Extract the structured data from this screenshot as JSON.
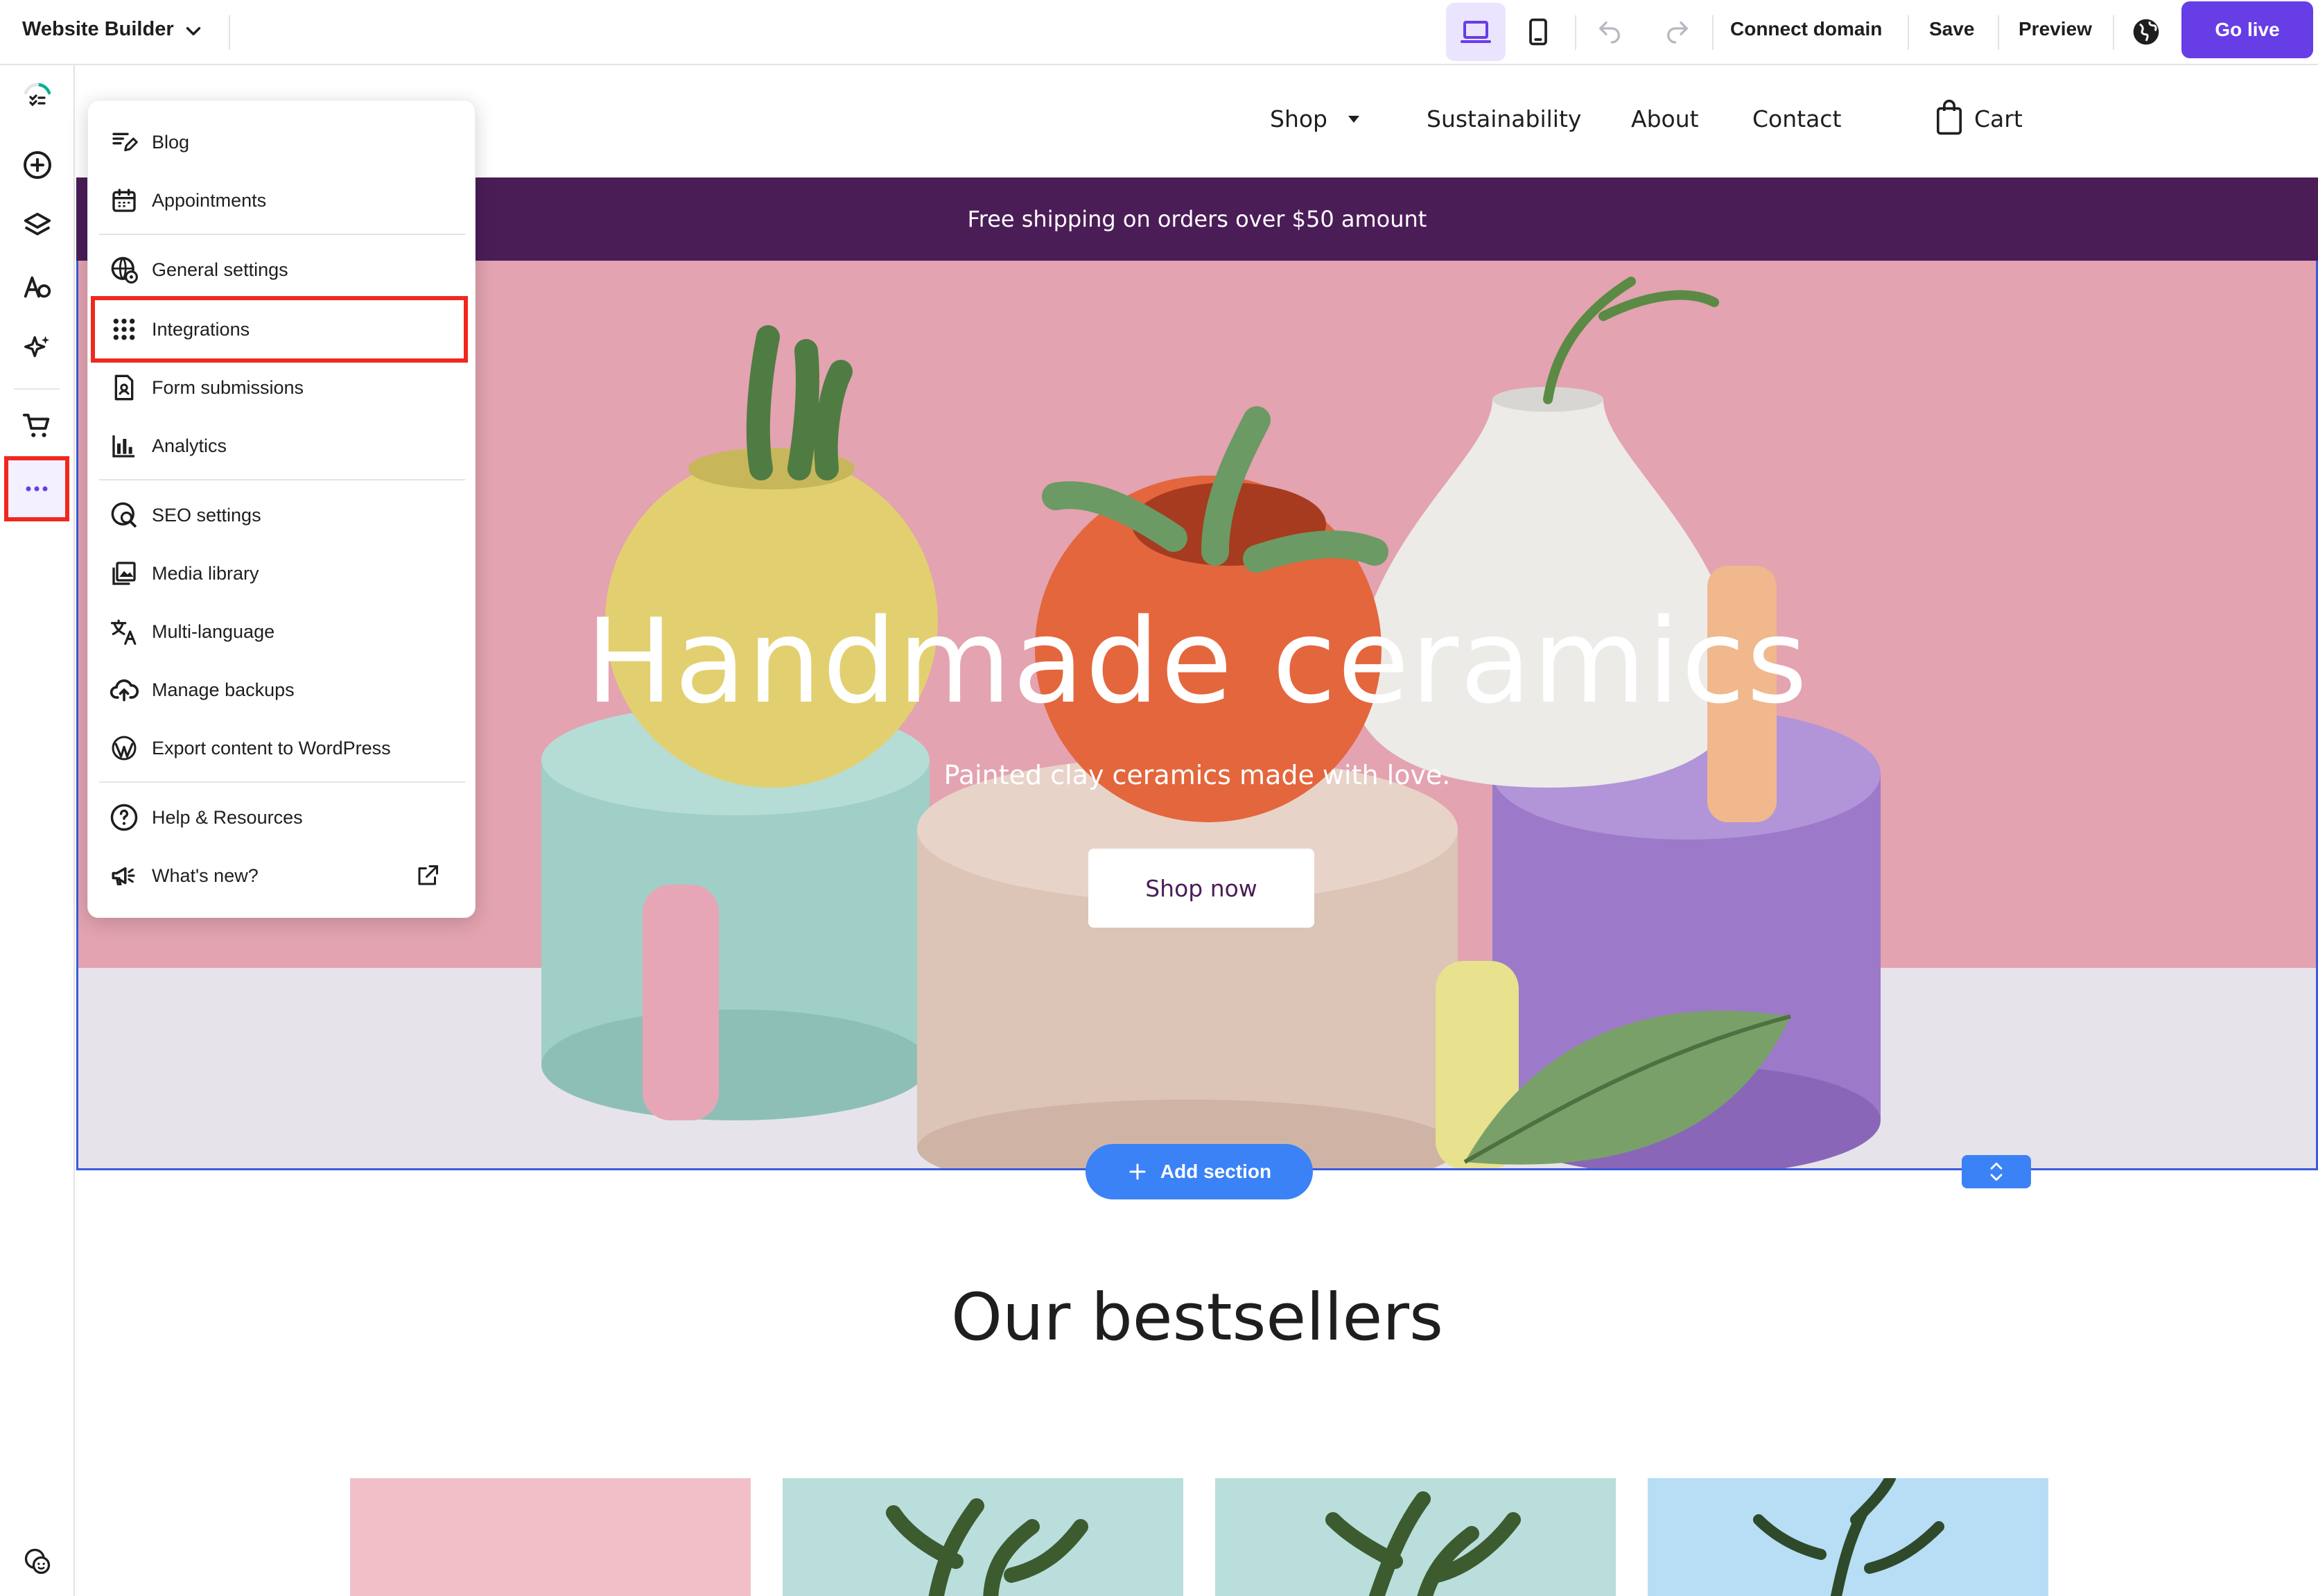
{
  "topbar": {
    "title": "Website Builder",
    "connect_domain": "Connect domain",
    "save": "Save",
    "preview": "Preview",
    "go_live": "Go live",
    "active_device": "desktop"
  },
  "leftrail": {
    "icons": [
      "progress-checklist-icon",
      "add-element-icon",
      "layers-icon",
      "styles-icon",
      "ai-tools-icon",
      "store-cart-icon",
      "more-icon",
      "help-chat-icon"
    ]
  },
  "menu": {
    "items": [
      {
        "label": "Blog",
        "icon": "blog-edit-icon"
      },
      {
        "label": "Appointments",
        "icon": "calendar-icon"
      },
      {
        "label": "General settings",
        "icon": "globe-settings-icon"
      },
      {
        "label": "Integrations",
        "icon": "grid-dots-icon",
        "highlighted": true
      },
      {
        "label": "Form submissions",
        "icon": "form-person-icon"
      },
      {
        "label": "Analytics",
        "icon": "bar-chart-icon"
      },
      {
        "label": "SEO settings",
        "icon": "seo-search-icon"
      },
      {
        "label": "Media library",
        "icon": "image-gallery-icon"
      },
      {
        "label": "Multi-language",
        "icon": "translate-icon"
      },
      {
        "label": "Manage backups",
        "icon": "cloud-upload-icon"
      },
      {
        "label": "Export content to WordPress",
        "icon": "wordpress-icon"
      },
      {
        "label": "Help & Resources",
        "icon": "help-circle-icon"
      },
      {
        "label": "What's new?",
        "icon": "megaphone-icon",
        "external": true
      }
    ]
  },
  "site": {
    "nav": {
      "shop": "Shop",
      "sustainability": "Sustainability",
      "about": "About",
      "contact": "Contact",
      "cart": "Cart"
    },
    "banner": "Free shipping on orders over $50 amount",
    "hero": {
      "title": "Handmade ceramics",
      "subtitle": "Painted clay ceramics made with love.",
      "button": "Shop now"
    },
    "add_section": "Add section",
    "bestsellers_title": "Our bestsellers"
  },
  "colors": {
    "brand": "#673de6",
    "banner": "#4b1d57",
    "selection": "#3b82f6",
    "highlight": "#f0281e"
  }
}
